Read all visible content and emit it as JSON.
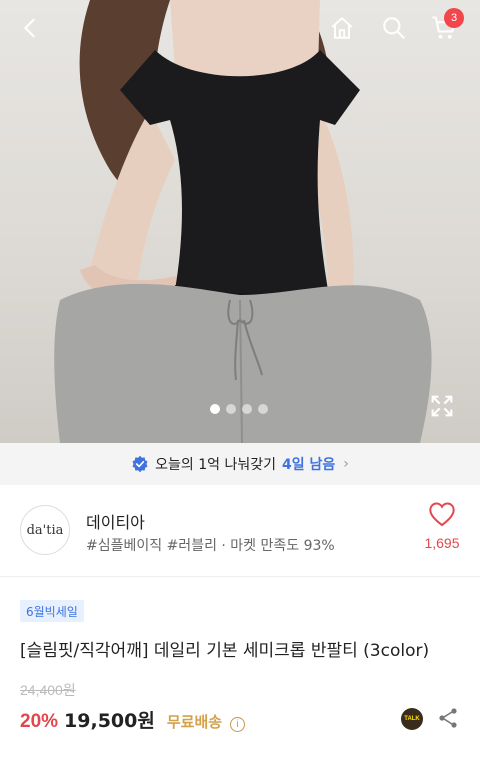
{
  "header": {
    "cart_count": "3"
  },
  "icons": {
    "back": "chevron-left-icon",
    "home": "home-icon",
    "search": "search-icon",
    "cart": "cart-icon",
    "expand": "expand-icon",
    "verified": "verified-check-icon",
    "heart": "heart-icon",
    "info": "info-icon",
    "talk": "kakaotalk-icon",
    "share": "share-icon"
  },
  "gallery": {
    "slide_count": 4,
    "active_index": 0
  },
  "promo": {
    "text": "오늘의 1억 나눠갖기",
    "days_left": "4일 남음",
    "chevron": "›"
  },
  "seller": {
    "logo_text": "da'tia",
    "name": "데이티아",
    "meta": "#심플베이직 #러블리 · 마켓 만족도 93%",
    "likes": "1,695"
  },
  "product": {
    "badge": "6월빅세일",
    "title": "[슬림핏/직각어깨] 데일리 기본 세미크롭 반팔티 (3color)",
    "original_price": "24,400원",
    "discount": "20%",
    "price": "19,500원",
    "shipping": "무료배송",
    "info_symbol": "i",
    "talk_label": "TALK"
  },
  "colors": {
    "accent_blue": "#3f73e0",
    "sale_red": "#e3474d",
    "badge_red": "#f2464b",
    "shipping_gold": "#d3a24b"
  }
}
